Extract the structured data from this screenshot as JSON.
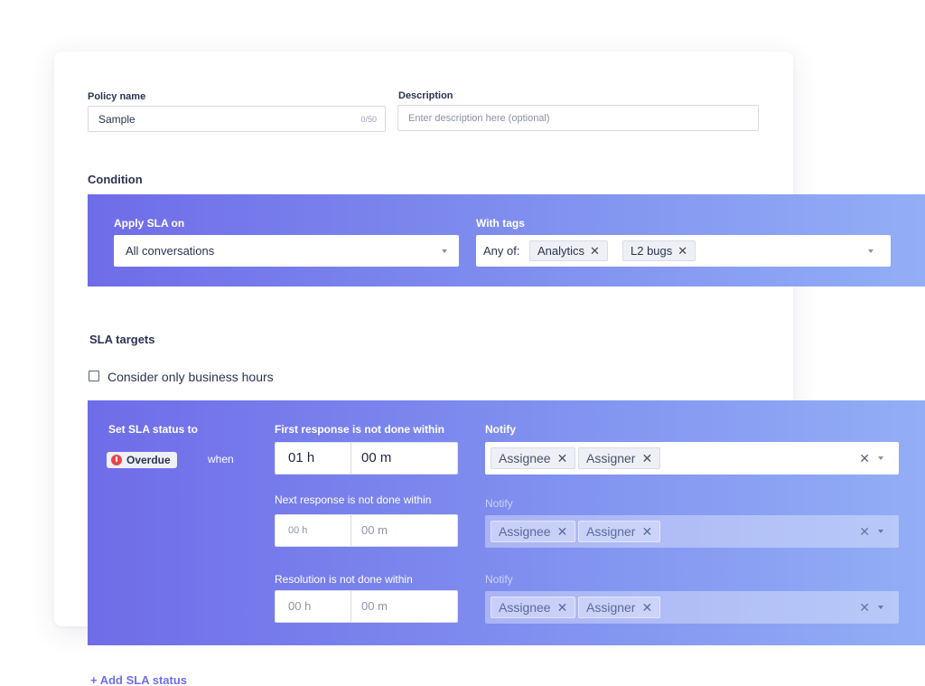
{
  "policy": {
    "name_label": "Policy name",
    "name_value": "Sample",
    "name_counter": "0/50",
    "description_label": "Description",
    "description_placeholder": "Enter description here (optional)"
  },
  "condition": {
    "title": "Condition",
    "apply_label": "Apply SLA on",
    "apply_value": "All conversations",
    "tags_label": "With tags",
    "tags_prefix": "Any of:",
    "tags": [
      "Analytics",
      "L2 bugs"
    ]
  },
  "sla_targets": {
    "title": "SLA targets",
    "business_hours_label": "Consider only business hours",
    "business_hours_checked": false,
    "status_label": "Set SLA status to",
    "status_badge": "Overdue",
    "when_label": "when",
    "rows": [
      {
        "label": "First response is not done within",
        "hours": "01 h",
        "minutes": "00 m",
        "notify_label": "Notify",
        "notify": [
          "Assignee",
          "Assigner"
        ]
      },
      {
        "label": "Next response is not done within",
        "hours": "00 h",
        "minutes": "00 m",
        "notify_label": "Notify",
        "notify": [
          "Assignee",
          "Assigner"
        ]
      },
      {
        "label": "Resolution is not done within",
        "hours": "00 h",
        "minutes": "00 m",
        "notify_label": "Notify",
        "notify": [
          "Assignee",
          "Assigner"
        ]
      }
    ],
    "add_status_label": "+ Add SLA status"
  },
  "colors": {
    "accent": "#6d6ff0",
    "band_start": "#6f6ce8",
    "band_end": "#93aef6",
    "overdue": "#e5484d"
  },
  "icons": {
    "remove": "close-icon",
    "dropdown": "chevron-down-icon",
    "overdue": "alert-circle-icon"
  }
}
